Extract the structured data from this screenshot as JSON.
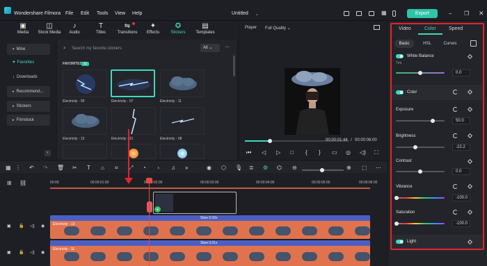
{
  "app": {
    "name": "Wondershare Filmora",
    "title": "Untitled",
    "export_label": "Export"
  },
  "menu": [
    "File",
    "Edit",
    "Tools",
    "View",
    "Help"
  ],
  "media_tabs": [
    {
      "label": "Media",
      "icon": "media-icon"
    },
    {
      "label": "Stock Media",
      "icon": "stock-media-icon"
    },
    {
      "label": "Audio",
      "icon": "music-note-icon"
    },
    {
      "label": "Titles",
      "icon": "titles-icon"
    },
    {
      "label": "Transitions",
      "icon": "transitions-icon"
    },
    {
      "label": "Effects",
      "icon": "effects-icon"
    },
    {
      "label": "Stickers",
      "icon": "stickers-icon"
    },
    {
      "label": "Templates",
      "icon": "templates-icon"
    }
  ],
  "sidebar": [
    "Mine",
    "Favorites",
    "Downloads",
    "Recommend...",
    "Stickers",
    "Filmstock"
  ],
  "search": {
    "placeholder": "Search my favorite stickers",
    "filter": "All"
  },
  "favorites": {
    "label": "FAVORITES",
    "count": "11"
  },
  "stickers": [
    "Electricity - 09",
    "Electricity - 07",
    "Electricity - 11",
    "Electricity - 13",
    "Electricity - 21",
    "Electricity - 08"
  ],
  "player": {
    "label": "Player",
    "quality": "Full Quality",
    "current_time": "00:00:01:44",
    "total_time": "00:00:06:00"
  },
  "timeline": {
    "ruler": [
      "00:00",
      "00:00:01:00",
      "00:00:02:00",
      "00:00:03:00",
      "00:00:04:00",
      "00:00:05:00",
      "00:00:06:00"
    ],
    "tracks": [
      {
        "label": "Electricity - 13",
        "speed": "Slow 0.03x"
      },
      {
        "label": "Electricity - 11",
        "speed": "Slow 0.01x"
      }
    ]
  },
  "panel": {
    "tabs": [
      "Video",
      "Color",
      "Speed"
    ],
    "subtabs": [
      "Basic",
      "HSL",
      "Curves"
    ],
    "white_balance": "White Balance",
    "tint": {
      "label": "Tint",
      "value": "0.0"
    },
    "color_section": "Color",
    "exposure": {
      "label": "Exposure",
      "value": "50.0"
    },
    "brightness": {
      "label": "Brightness",
      "value": "-22.2"
    },
    "contrast": {
      "label": "Contrast",
      "value": "0.0"
    },
    "vibrance": {
      "label": "Vibrance",
      "value": "-100.0"
    },
    "saturation": {
      "label": "Saturation",
      "value": "-100.0"
    },
    "light_section": "Light"
  }
}
